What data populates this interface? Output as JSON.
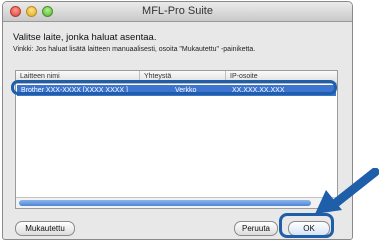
{
  "window": {
    "title": "MFL-Pro Suite"
  },
  "heading": "Valitse laite, jonka haluat asentaa.",
  "hint": "Vinkki: Jos haluat lisätä laitteen manuaalisesti, osoita \"Mukautettu\" -painiketta.",
  "table": {
    "columns": [
      "Laitteen nimi",
      "Yhteystä",
      "IP-osoite"
    ],
    "rows": [
      {
        "name": "Brother XXX-XXXX [XXXX XXXX ]",
        "connection": "Verkko",
        "ip": "XX.XXX.XX.XXX"
      }
    ]
  },
  "buttons": {
    "custom": "Mukautettu",
    "cancel": "Peruuta",
    "ok": "OK"
  },
  "scrollbar": {
    "arrows": "◂ ▸"
  },
  "colors": {
    "highlight": "#1f5fa9",
    "selection": "#3d74cf"
  }
}
